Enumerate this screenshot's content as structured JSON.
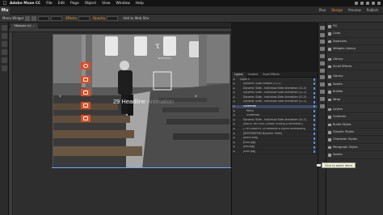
{
  "menubar": {
    "items": [
      "Adobe Muse CC",
      "File",
      "Edit",
      "Page",
      "Object",
      "View",
      "Window",
      "Help"
    ]
  },
  "appbar": {
    "logo": "Mu",
    "workspaces": [
      "Plan",
      "Design",
      "Preview",
      "Publish"
    ]
  },
  "controlbar": {
    "label": "Menu Widget",
    "effects_label": "Effects",
    "opacity_label": "Opacity",
    "edit_link": "Add to Web Site"
  },
  "document": {
    "tab": "*Website Ic1 ..."
  },
  "canvas": {
    "headline": "29 Headline",
    "headline_tail": "Animation",
    "logo_sub": "WIDGETS"
  },
  "layers_panel": {
    "tabs": [
      "Layers",
      "Content",
      "Scroll Effects"
    ],
    "rows": [
      {
        "text": "Layer 1",
        "depth": 0,
        "selected": false
      },
      {
        "text": "Dynamic Slide Enabler (11.2)",
        "depth": 1,
        "selected": false
      },
      {
        "text": "Dynamic Slide - Individual Slide Animation (11.2)",
        "depth": 1,
        "selected": false
      },
      {
        "text": "Dynamic Slide - Individual Slide Animation (11.2)",
        "depth": 1,
        "selected": false
      },
      {
        "text": "Dynamic Slide - Individual Slide Animation (11.2)",
        "depth": 1,
        "selected": false
      },
      {
        "text": "Dynamic Slide - Individual Slide Animation (11.2)",
        "depth": 1,
        "selected": false
      },
      {
        "text": "Slideshow",
        "depth": 1,
        "selected": true
      },
      {
        "text": "Menu",
        "depth": 2,
        "selected": false
      },
      {
        "text": "Slideshow",
        "depth": 2,
        "selected": false
      },
      {
        "text": "Dynamic Slide - Individual Slide Animation (11.1)",
        "depth": 1,
        "selected": false
      },
      {
        "text": "[MAGIC MOTION Custom Scaling & Animation]",
        "depth": 1,
        "selected": false
      },
      {
        "text": "[TYPOGRAPHY 29 Headline & Byline Animations]",
        "depth": 1,
        "selected": false
      },
      {
        "text": "[INTEGRATION Dynamic Slide]",
        "depth": 1,
        "selected": false
      },
      {
        "text": "[block.png]",
        "depth": 1,
        "selected": false
      },
      {
        "text": "[icon.jpg]",
        "depth": 1,
        "selected": false
      },
      {
        "text": "[nav.jpg]",
        "depth": 1,
        "selected": false
      },
      {
        "text": "[icon.jpg]",
        "depth": 1,
        "selected": false
      }
    ]
  },
  "panel_dock": {
    "items": [
      "Fill",
      "Color",
      "Swatches",
      "Widgets Library",
      "Library",
      "Scroll Effects",
      "Library",
      "Assets",
      "Bullets",
      "Wrap",
      "Layers",
      "Contents",
      "Bullet Styles",
      "Graphic Styles",
      "Character Styles",
      "Paragraph Styles",
      "Assets"
    ],
    "gap_before": [
      4,
      6,
      10
    ]
  },
  "tooltip": "Click to select items"
}
